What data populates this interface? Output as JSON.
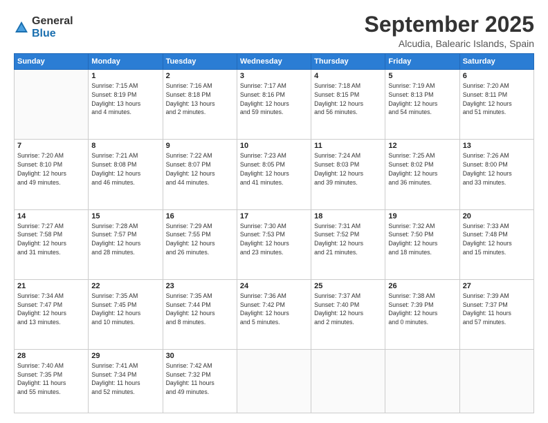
{
  "logo": {
    "general": "General",
    "blue": "Blue"
  },
  "header": {
    "month": "September 2025",
    "location": "Alcudia, Balearic Islands, Spain"
  },
  "weekdays": [
    "Sunday",
    "Monday",
    "Tuesday",
    "Wednesday",
    "Thursday",
    "Friday",
    "Saturday"
  ],
  "weeks": [
    [
      {
        "day": "",
        "info": ""
      },
      {
        "day": "1",
        "info": "Sunrise: 7:15 AM\nSunset: 8:19 PM\nDaylight: 13 hours\nand 4 minutes."
      },
      {
        "day": "2",
        "info": "Sunrise: 7:16 AM\nSunset: 8:18 PM\nDaylight: 13 hours\nand 2 minutes."
      },
      {
        "day": "3",
        "info": "Sunrise: 7:17 AM\nSunset: 8:16 PM\nDaylight: 12 hours\nand 59 minutes."
      },
      {
        "day": "4",
        "info": "Sunrise: 7:18 AM\nSunset: 8:15 PM\nDaylight: 12 hours\nand 56 minutes."
      },
      {
        "day": "5",
        "info": "Sunrise: 7:19 AM\nSunset: 8:13 PM\nDaylight: 12 hours\nand 54 minutes."
      },
      {
        "day": "6",
        "info": "Sunrise: 7:20 AM\nSunset: 8:11 PM\nDaylight: 12 hours\nand 51 minutes."
      }
    ],
    [
      {
        "day": "7",
        "info": "Sunrise: 7:20 AM\nSunset: 8:10 PM\nDaylight: 12 hours\nand 49 minutes."
      },
      {
        "day": "8",
        "info": "Sunrise: 7:21 AM\nSunset: 8:08 PM\nDaylight: 12 hours\nand 46 minutes."
      },
      {
        "day": "9",
        "info": "Sunrise: 7:22 AM\nSunset: 8:07 PM\nDaylight: 12 hours\nand 44 minutes."
      },
      {
        "day": "10",
        "info": "Sunrise: 7:23 AM\nSunset: 8:05 PM\nDaylight: 12 hours\nand 41 minutes."
      },
      {
        "day": "11",
        "info": "Sunrise: 7:24 AM\nSunset: 8:03 PM\nDaylight: 12 hours\nand 39 minutes."
      },
      {
        "day": "12",
        "info": "Sunrise: 7:25 AM\nSunset: 8:02 PM\nDaylight: 12 hours\nand 36 minutes."
      },
      {
        "day": "13",
        "info": "Sunrise: 7:26 AM\nSunset: 8:00 PM\nDaylight: 12 hours\nand 33 minutes."
      }
    ],
    [
      {
        "day": "14",
        "info": "Sunrise: 7:27 AM\nSunset: 7:58 PM\nDaylight: 12 hours\nand 31 minutes."
      },
      {
        "day": "15",
        "info": "Sunrise: 7:28 AM\nSunset: 7:57 PM\nDaylight: 12 hours\nand 28 minutes."
      },
      {
        "day": "16",
        "info": "Sunrise: 7:29 AM\nSunset: 7:55 PM\nDaylight: 12 hours\nand 26 minutes."
      },
      {
        "day": "17",
        "info": "Sunrise: 7:30 AM\nSunset: 7:53 PM\nDaylight: 12 hours\nand 23 minutes."
      },
      {
        "day": "18",
        "info": "Sunrise: 7:31 AM\nSunset: 7:52 PM\nDaylight: 12 hours\nand 21 minutes."
      },
      {
        "day": "19",
        "info": "Sunrise: 7:32 AM\nSunset: 7:50 PM\nDaylight: 12 hours\nand 18 minutes."
      },
      {
        "day": "20",
        "info": "Sunrise: 7:33 AM\nSunset: 7:48 PM\nDaylight: 12 hours\nand 15 minutes."
      }
    ],
    [
      {
        "day": "21",
        "info": "Sunrise: 7:34 AM\nSunset: 7:47 PM\nDaylight: 12 hours\nand 13 minutes."
      },
      {
        "day": "22",
        "info": "Sunrise: 7:35 AM\nSunset: 7:45 PM\nDaylight: 12 hours\nand 10 minutes."
      },
      {
        "day": "23",
        "info": "Sunrise: 7:35 AM\nSunset: 7:44 PM\nDaylight: 12 hours\nand 8 minutes."
      },
      {
        "day": "24",
        "info": "Sunrise: 7:36 AM\nSunset: 7:42 PM\nDaylight: 12 hours\nand 5 minutes."
      },
      {
        "day": "25",
        "info": "Sunrise: 7:37 AM\nSunset: 7:40 PM\nDaylight: 12 hours\nand 2 minutes."
      },
      {
        "day": "26",
        "info": "Sunrise: 7:38 AM\nSunset: 7:39 PM\nDaylight: 12 hours\nand 0 minutes."
      },
      {
        "day": "27",
        "info": "Sunrise: 7:39 AM\nSunset: 7:37 PM\nDaylight: 11 hours\nand 57 minutes."
      }
    ],
    [
      {
        "day": "28",
        "info": "Sunrise: 7:40 AM\nSunset: 7:35 PM\nDaylight: 11 hours\nand 55 minutes."
      },
      {
        "day": "29",
        "info": "Sunrise: 7:41 AM\nSunset: 7:34 PM\nDaylight: 11 hours\nand 52 minutes."
      },
      {
        "day": "30",
        "info": "Sunrise: 7:42 AM\nSunset: 7:32 PM\nDaylight: 11 hours\nand 49 minutes."
      },
      {
        "day": "",
        "info": ""
      },
      {
        "day": "",
        "info": ""
      },
      {
        "day": "",
        "info": ""
      },
      {
        "day": "",
        "info": ""
      }
    ]
  ]
}
